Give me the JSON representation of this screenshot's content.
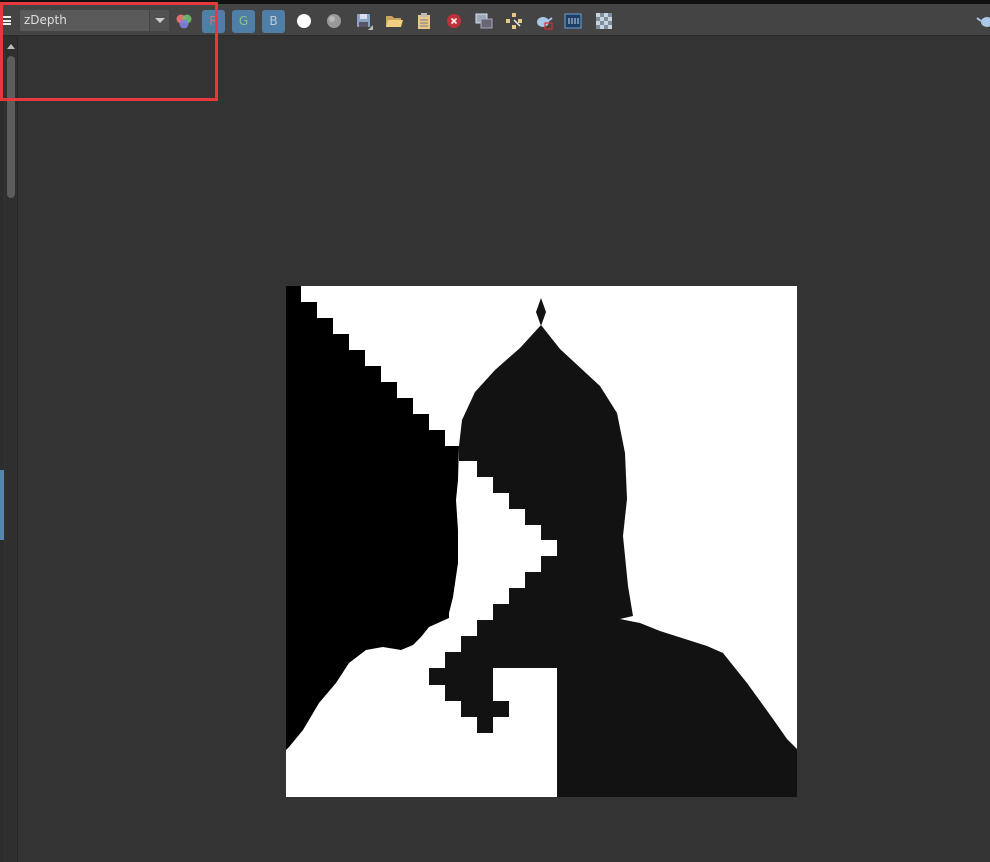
{
  "toolbar": {
    "channel_select": {
      "value": "zDepth"
    },
    "buttons": [
      {
        "name": "rgb-channels-icon"
      },
      {
        "name": "red-channel-button",
        "label": "R"
      },
      {
        "name": "green-channel-button",
        "label": "G"
      },
      {
        "name": "blue-channel-button",
        "label": "B"
      },
      {
        "name": "white-sphere-icon"
      },
      {
        "name": "gray-sphere-icon"
      },
      {
        "name": "save-icon"
      },
      {
        "name": "open-folder-icon"
      },
      {
        "name": "clipboard-icon"
      },
      {
        "name": "close-red-icon"
      },
      {
        "name": "snapshot-icon"
      },
      {
        "name": "region-select-icon"
      },
      {
        "name": "teapot-render-icon"
      },
      {
        "name": "film-strip-icon"
      },
      {
        "name": "checker-icon"
      },
      {
        "name": "teapot-icon"
      }
    ]
  },
  "colors": {
    "accent": "#4f7fa6",
    "highlight": "#e8383b",
    "background": "#333333"
  }
}
